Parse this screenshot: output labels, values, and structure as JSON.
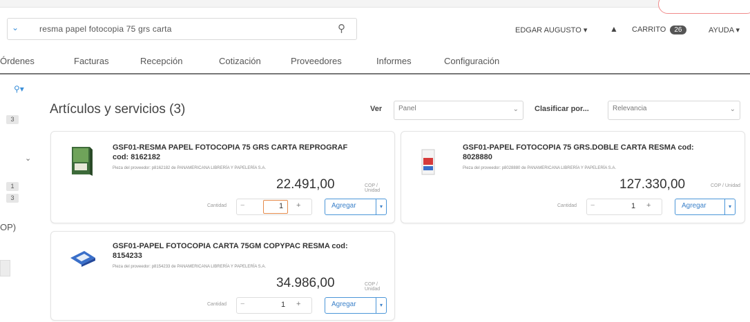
{
  "header": {
    "search_value": "resma papel fotocopia 75 grs carta",
    "user": "EDGAR AUGUSTO",
    "cart_label": "CARRITO",
    "cart_count": "26",
    "help_label": "AYUDA"
  },
  "nav": {
    "items": [
      "Órdenes",
      "Facturas",
      "Recepción",
      "Cotización",
      "Proveedores",
      "Informes",
      "Configuración"
    ]
  },
  "sidebar": {
    "badges": [
      "3",
      "1",
      "3"
    ],
    "partial_text": "OP)"
  },
  "main": {
    "title": "Artículos y servicios (3)",
    "view_label": "Ver",
    "view_value": "Panel",
    "sort_label": "Clasificar por...",
    "sort_value": "Relevancia"
  },
  "products": [
    {
      "title_line1": "GSF01-RESMA PAPEL FOTOCOPIA 75 GRS CARTA REPROGRAF",
      "title_line2": "cod: 8162182",
      "supplier": "Pieza del proveedor: p8162182 de PANAMERICANA LIBRERÍA Y PAPELERÍA S.A.",
      "price": "22.491,00",
      "unit": "COP / Unidad",
      "qty_label": "Cantidad",
      "qty": "1",
      "add_label": "Agregar"
    },
    {
      "title_line1": "GSF01-PAPEL FOTOCOPIA 75 GRS.DOBLE CARTA RESMA cod:",
      "title_line2": "8028880",
      "supplier": "Pieza del proveedor: p8028880 de PANAMERICANA LIBRERÍA Y PAPELERÍA S.A.",
      "price": "127.330,00",
      "unit": "COP / Unidad",
      "qty_label": "Cantidad",
      "qty": "1",
      "add_label": "Agregar"
    },
    {
      "title_line1": "GSF01-PAPEL FOTOCOPIA CARTA 75GM COPYPAC RESMA cod:",
      "title_line2": "8154233",
      "supplier": "Pieza del proveedor: p8154233 de PANAMERICANA LIBRERÍA Y PAPELERÍA S.A.",
      "price": "34.986,00",
      "unit": "COP / Unidad",
      "qty_label": "Cantidad",
      "qty": "1",
      "add_label": "Agregar"
    }
  ]
}
